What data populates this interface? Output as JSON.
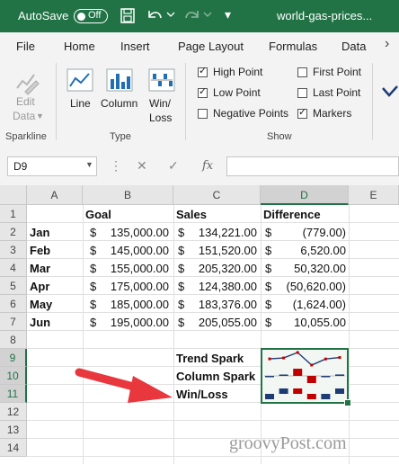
{
  "titlebar": {
    "autosave_label": "AutoSave",
    "autosave_state": "Off",
    "filename": "world-gas-prices..."
  },
  "menu": [
    "File",
    "Home",
    "Insert",
    "Page Layout",
    "Formulas",
    "Data"
  ],
  "ribbon": {
    "sparkline_group": {
      "label": "Sparkline",
      "edit_data_line1": "Edit",
      "edit_data_line2": "Data"
    },
    "type_group": {
      "label": "Type",
      "line": "Line",
      "column": "Column",
      "winloss_line1": "Win/",
      "winloss_line2": "Loss"
    },
    "show_group": {
      "label": "Show",
      "high_point": "High Point",
      "low_point": "Low Point",
      "negative_points": "Negative Points",
      "first_point": "First Point",
      "last_point": "Last Point",
      "markers": "Markers"
    }
  },
  "formula_bar": {
    "name_box": "D9",
    "fx": "fx",
    "formula": ""
  },
  "columns": [
    "A",
    "B",
    "C",
    "D",
    "E"
  ],
  "rows": [
    "1",
    "2",
    "3",
    "4",
    "5",
    "6",
    "7",
    "8",
    "9",
    "10",
    "11",
    "12",
    "13",
    "14"
  ],
  "sheet": {
    "headers": {
      "goal": "Goal",
      "sales": "Sales",
      "difference": "Difference"
    },
    "data": [
      {
        "month": "Jan",
        "goal": "135,000.00",
        "sales": "134,221.00",
        "diff": "(779.00)"
      },
      {
        "month": "Feb",
        "goal": "145,000.00",
        "sales": "151,520.00",
        "diff": "6,520.00"
      },
      {
        "month": "Mar",
        "goal": "155,000.00",
        "sales": "205,320.00",
        "diff": "50,320.00"
      },
      {
        "month": "Apr",
        "goal": "175,000.00",
        "sales": "124,380.00",
        "diff": "(50,620.00)"
      },
      {
        "month": "May",
        "goal": "185,000.00",
        "sales": "183,376.00",
        "diff": "(1,624.00)"
      },
      {
        "month": "Jun",
        "goal": "195,000.00",
        "sales": "205,055.00",
        "diff": "10,055.00"
      }
    ],
    "currency": "$",
    "labels": {
      "trend": "Trend Spark",
      "column": "Column Spark",
      "winloss": "Win/Loss"
    }
  },
  "watermark": "groovyPost.com",
  "colors": {
    "excel_green": "#217346",
    "arrow": "#e8383d",
    "spark_line": "#1f3b73",
    "spark_marker": "#c00000"
  },
  "sparkline_values": [
    -779,
    6520,
    50320,
    -50620,
    -1624,
    10055
  ]
}
